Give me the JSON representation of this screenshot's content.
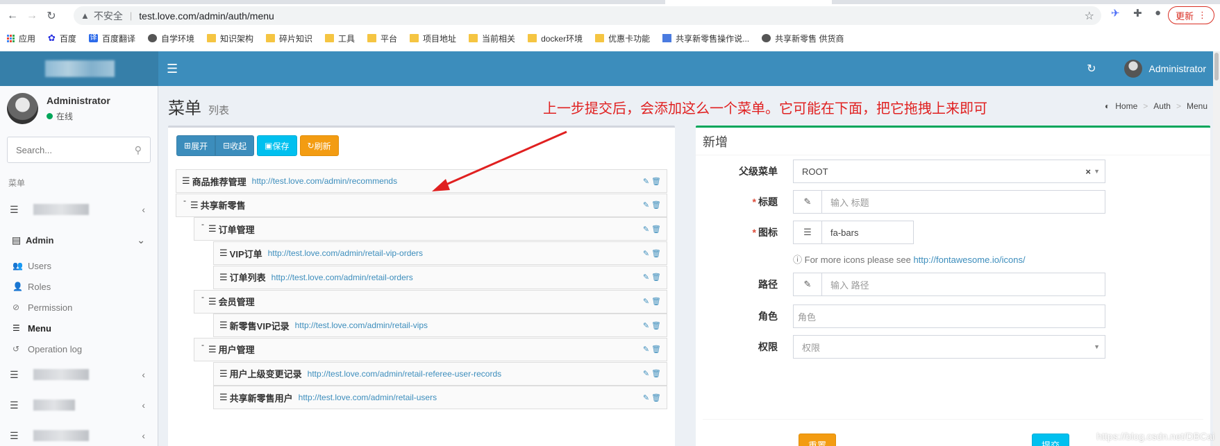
{
  "browser": {
    "back": "←",
    "forward": "→",
    "reload": "↻",
    "insecure_label": "不安全",
    "url": "test.love.com/admin/auth/menu",
    "update_label": "更新",
    "bookmarks": [
      {
        "label": "应用",
        "icon": "apps-icon"
      },
      {
        "label": "百度",
        "icon": "baidu-icon"
      },
      {
        "label": "百度翻译",
        "icon": "translate-icon"
      },
      {
        "label": "自学环境",
        "icon": "globe-icon"
      },
      {
        "label": "知识架构",
        "icon": "folder-icon"
      },
      {
        "label": "碎片知识",
        "icon": "folder-icon"
      },
      {
        "label": "工具",
        "icon": "folder-icon"
      },
      {
        "label": "平台",
        "icon": "folder-icon"
      },
      {
        "label": "项目地址",
        "icon": "folder-icon"
      },
      {
        "label": "当前相关",
        "icon": "folder-icon"
      },
      {
        "label": "docker环境",
        "icon": "folder-icon"
      },
      {
        "label": "优惠卡功能",
        "icon": "folder-icon"
      },
      {
        "label": "共享新零售操作说...",
        "icon": "doc-icon"
      },
      {
        "label": "共享新零售 供货商",
        "icon": "globe-icon"
      }
    ]
  },
  "header": {
    "user_name": "Administrator"
  },
  "sidebar": {
    "user_name": "Administrator",
    "status": "在线",
    "search_placeholder": "Search...",
    "section_label": "菜单",
    "admin_label": "Admin",
    "sub_items": [
      {
        "label": "Users"
      },
      {
        "label": "Roles"
      },
      {
        "label": "Permission"
      },
      {
        "label": "Menu"
      },
      {
        "label": "Operation log"
      }
    ]
  },
  "page": {
    "title": "菜单",
    "subtitle": "列表",
    "annotation": "上一步提交后，会添加这么一个菜单。它可能在下面，把它拖拽上来即可",
    "breadcrumb": [
      "Home",
      "Auth",
      "Menu"
    ]
  },
  "toolbar": {
    "expand": "展开",
    "collapse": "收起",
    "save": "保存",
    "refresh": "刷新"
  },
  "tree": [
    {
      "title": "商品推荐管理",
      "url": "http://test.love.com/admin/recommends",
      "level": 0
    },
    {
      "title": "共享新零售",
      "url": "",
      "level": 0,
      "parent": true
    },
    {
      "title": "订单管理",
      "url": "",
      "level": 1,
      "parent": true
    },
    {
      "title": "VIP订单",
      "url": "http://test.love.com/admin/retail-vip-orders",
      "level": 2
    },
    {
      "title": "订单列表",
      "url": "http://test.love.com/admin/retail-orders",
      "level": 2
    },
    {
      "title": "会员管理",
      "url": "",
      "level": 1,
      "parent": true
    },
    {
      "title": "新零售VIP记录",
      "url": "http://test.love.com/admin/retail-vips",
      "level": 2
    },
    {
      "title": "用户管理",
      "url": "",
      "level": 1,
      "parent": true
    },
    {
      "title": "用户上级变更记录",
      "url": "http://test.love.com/admin/retail-referee-user-records",
      "level": 2
    },
    {
      "title": "共享新零售用户",
      "url": "http://test.love.com/admin/retail-users",
      "level": 2
    }
  ],
  "form": {
    "title": "新增",
    "parent_label": "父级菜单",
    "parent_value": "ROOT",
    "title_label": "标题",
    "title_placeholder": "输入 标题",
    "icon_label": "图标",
    "icon_value": "fa-bars",
    "icon_help": "For more icons please see",
    "icon_help_link": "http://fontawesome.io/icons/",
    "uri_label": "路径",
    "uri_placeholder": "输入 路径",
    "roles_label": "角色",
    "roles_placeholder": "角色",
    "permission_label": "权限",
    "permission_placeholder": "权限",
    "reset": "重置",
    "submit": "提交"
  },
  "watermark": "https://blog.csdn.net/DBCai",
  "colors": {
    "header": "#3c8dbc",
    "logo": "#367fa9",
    "annotation": "#e02020",
    "success_border": "#00a65a",
    "warning": "#f39c12",
    "info": "#00c0ef"
  }
}
